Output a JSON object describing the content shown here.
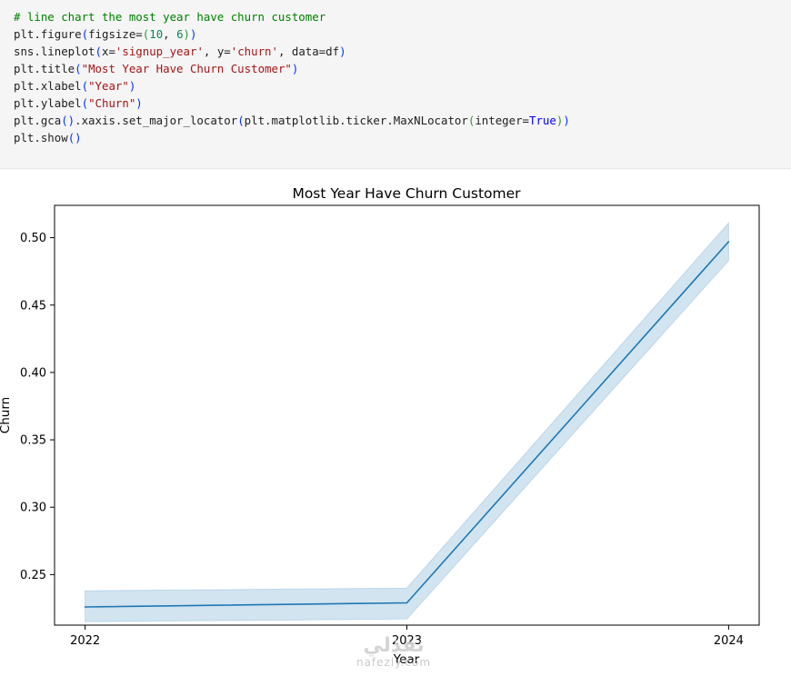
{
  "code_cell": {
    "comment": "# line chart the most year have churn customer",
    "line_figure": {
      "fn": "plt.figure",
      "arg_name": "figsize=",
      "n1": "10",
      "n2": "6"
    },
    "line_lineplot": {
      "fn": "sns.lineplot",
      "arg_x": "x=",
      "x_val": "'signup_year'",
      "arg_y": ", y=",
      "y_val": "'churn'",
      "rest": ", data=df"
    },
    "line_title": {
      "fn": "plt.title",
      "val": "\"Most Year Have Churn Customer\""
    },
    "line_xlabel": {
      "fn": "plt.xlabel",
      "val": "\"Year\""
    },
    "line_ylabel": {
      "fn": "plt.ylabel",
      "val": "\"Churn\""
    },
    "line_gca": {
      "fn": "plt.gca",
      "mid": ".xaxis.set_major_locator",
      "inner": "plt.matplotlib.ticker.MaxNLocator",
      "arg": "integer=",
      "kw": "True"
    },
    "line_show": {
      "fn": "plt.show"
    }
  },
  "chart_data": {
    "type": "line",
    "title": "Most Year Have Churn Customer",
    "xlabel": "Year",
    "ylabel": "Churn",
    "x": [
      2022,
      2023,
      2024
    ],
    "series": [
      {
        "values": [
          0.226,
          0.229,
          0.497
        ],
        "ci_low": [
          0.215,
          0.217,
          0.483
        ],
        "ci_high": [
          0.238,
          0.24,
          0.511
        ],
        "color": "#1f77b4"
      }
    ],
    "xlim": [
      2021.905,
      2024.095
    ],
    "ylim": [
      0.2125,
      0.524
    ],
    "x_ticks": [
      "2022",
      "2023",
      "2024"
    ],
    "y_ticks": [
      "0.25",
      "0.30",
      "0.35",
      "0.40",
      "0.45",
      "0.50"
    ],
    "grid": false
  },
  "watermark": {
    "arabic": "نفذلي",
    "latin": "nafezly.com"
  }
}
